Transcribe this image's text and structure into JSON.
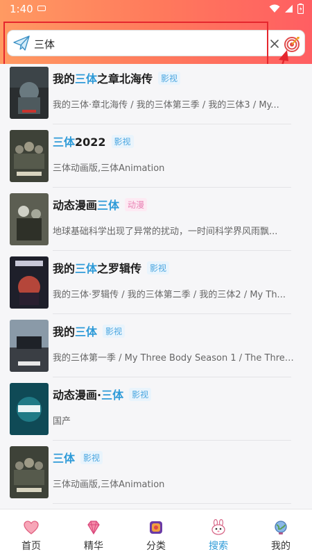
{
  "status_bar": {
    "time": "1:40"
  },
  "search": {
    "value": "三体",
    "clear_label": "×"
  },
  "results": [
    {
      "title_parts": [
        "我的",
        "三体",
        "之章北海传"
      ],
      "tag": "影视",
      "tag_type": "movie",
      "desc": "我的三体·章北海传 / 我的三体第三季 / 我的三体3 / My..."
    },
    {
      "title_parts": [
        "",
        "三体",
        "2022"
      ],
      "tag": "影视",
      "tag_type": "movie",
      "desc": "三体动画版,三体Animation"
    },
    {
      "title_parts": [
        "动态漫画",
        "三体",
        ""
      ],
      "tag": "动漫",
      "tag_type": "anime",
      "desc": "地球基础科学出现了异常的扰动，一时间科学界风雨飘..."
    },
    {
      "title_parts": [
        "我的",
        "三体",
        "之罗辑传"
      ],
      "tag": "影视",
      "tag_type": "movie",
      "desc": "我的三体·罗辑传 / 我的三体第二季 / 我的三体2 / My Th..."
    },
    {
      "title_parts": [
        "我的",
        "三体",
        ""
      ],
      "tag": "影视",
      "tag_type": "movie",
      "desc": "我的三体第一季 / My Three Body Season 1 / The Three-..."
    },
    {
      "title_parts": [
        "动态漫画·",
        "三体",
        ""
      ],
      "tag": "影视",
      "tag_type": "movie",
      "desc": "国产"
    },
    {
      "title_parts": [
        "",
        "三体",
        ""
      ],
      "tag": "影视",
      "tag_type": "movie",
      "desc": "三体动画版,三体Animation"
    }
  ],
  "bottom_nav": [
    {
      "label": "首页",
      "icon": "heart-icon",
      "active": false
    },
    {
      "label": "精华",
      "icon": "diamond-icon",
      "active": false
    },
    {
      "label": "分类",
      "icon": "category-icon",
      "active": false
    },
    {
      "label": "搜索",
      "icon": "search-bunny-icon",
      "active": true
    },
    {
      "label": "我的",
      "icon": "globe-icon",
      "active": false
    }
  ],
  "colors": {
    "header_start": "#ff9a62",
    "header_end": "#ff5e62",
    "highlight": "#2f9bd8",
    "annotation": "#e5262d"
  }
}
